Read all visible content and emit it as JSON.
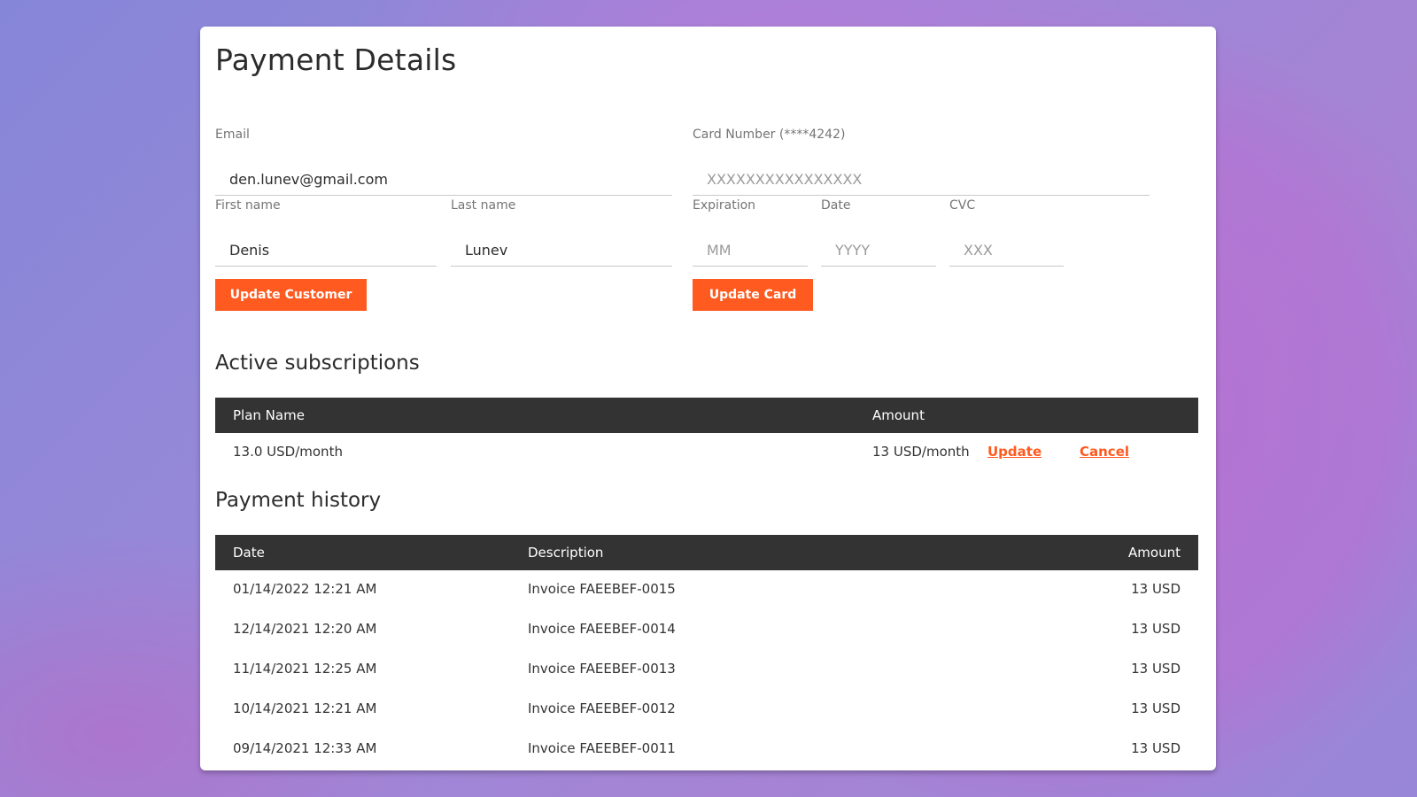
{
  "page": {
    "title": "Payment Details"
  },
  "customer": {
    "email_label": "Email",
    "email_value": "den.lunev@gmail.com",
    "first_name_label": "First name",
    "first_name_value": "Denis",
    "last_name_label": "Last name",
    "last_name_value": "Lunev",
    "update_button": "Update Customer"
  },
  "card": {
    "number_label": "Card Number (****4242)",
    "number_placeholder": "XXXXXXXXXXXXXXXX",
    "expiration_label": "Expiration",
    "month_placeholder": "MM",
    "date_label": "Date",
    "year_placeholder": "YYYY",
    "cvc_label": "CVC",
    "cvc_placeholder": "XXX",
    "update_button": "Update Card"
  },
  "subscriptions": {
    "title": "Active subscriptions",
    "columns": [
      "Plan Name",
      "Amount"
    ],
    "rows": [
      {
        "plan_name": "13.0 USD/month",
        "amount": "13 USD/month",
        "update_label": "Update",
        "cancel_label": "Cancel"
      }
    ]
  },
  "history": {
    "title": "Payment history",
    "columns": [
      "Date",
      "Description",
      "Amount"
    ],
    "rows": [
      {
        "date": "01/14/2022 12:21 AM",
        "description": "Invoice FAEEBEF-0015",
        "amount": "13 USD"
      },
      {
        "date": "12/14/2021 12:20 AM",
        "description": "Invoice FAEEBEF-0014",
        "amount": "13 USD"
      },
      {
        "date": "11/14/2021 12:25 AM",
        "description": "Invoice FAEEBEF-0013",
        "amount": "13 USD"
      },
      {
        "date": "10/14/2021 12:21 AM",
        "description": "Invoice FAEEBEF-0012",
        "amount": "13 USD"
      },
      {
        "date": "09/14/2021 12:33 AM",
        "description": "Invoice FAEEBEF-0011",
        "amount": "13 USD"
      }
    ]
  },
  "colors": {
    "accent": "#ff5a1f",
    "table_header": "#333333"
  }
}
